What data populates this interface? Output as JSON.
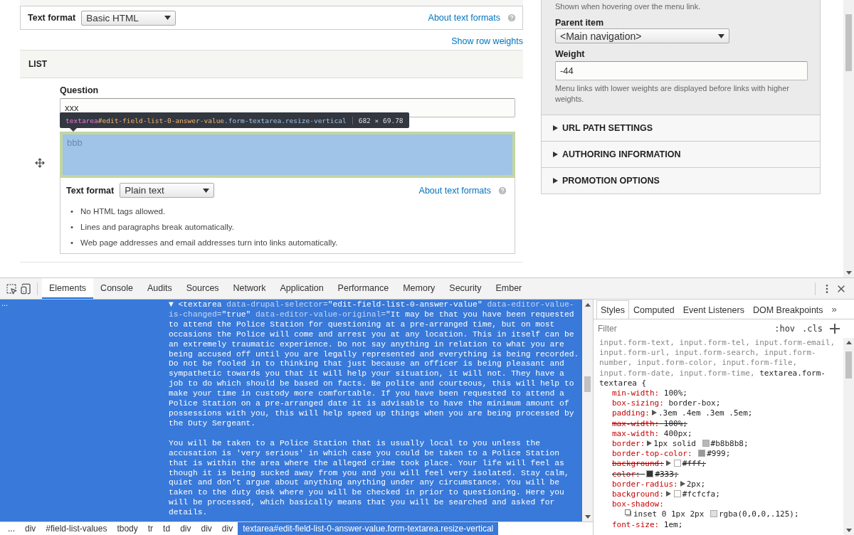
{
  "page": {
    "top_format": {
      "label": "Text format",
      "select": "Basic HTML",
      "link": "About text formats"
    },
    "show_row_weights": "Show row weights",
    "list_header": "LIST",
    "question": {
      "label": "Question",
      "value": "xxx"
    },
    "answer": {
      "value": "bbb",
      "highlighted": true
    },
    "tooltip": {
      "tag": "textarea",
      "id": "#edit-field-list-0-answer-value",
      "classes": ".form-textarea.resize-vertical",
      "size": "682 × 69.78"
    },
    "answer_format": {
      "label": "Text format",
      "select": "Plain text",
      "link": "About text formats",
      "bullet": "•",
      "tips": [
        "No HTML tags allowed.",
        "Lines and paragraphs break automatically.",
        "Web page addresses and email addresses turn into links automatically."
      ]
    }
  },
  "sidebar": {
    "hover_note": "Shown when hovering over the menu link.",
    "parent_label": "Parent item",
    "parent_select": "<Main navigation>",
    "weight_label": "Weight",
    "weight_value": "-44",
    "weight_note": "Menu links with lower weights are displayed before links with higher weights.",
    "sections": [
      {
        "title": "URL PATH SETTINGS",
        "expanded": false
      },
      {
        "title": "AUTHORING INFORMATION",
        "expanded": false
      },
      {
        "title": "PROMOTION OPTIONS",
        "expanded": false
      }
    ]
  },
  "devtools": {
    "tabs": [
      {
        "label": "Elements",
        "selected": true
      },
      {
        "label": "Console",
        "selected": false
      },
      {
        "label": "Audits",
        "selected": false
      },
      {
        "label": "Sources",
        "selected": false
      },
      {
        "label": "Network",
        "selected": false
      },
      {
        "label": "Application",
        "selected": false
      },
      {
        "label": "Performance",
        "selected": false
      },
      {
        "label": "Memory",
        "selected": false
      },
      {
        "label": "Security",
        "selected": false
      },
      {
        "label": "Ember",
        "selected": false
      }
    ],
    "dom": {
      "gutter": "...",
      "toggle": "▼",
      "element": [
        {
          "kind": "tag",
          "text": "<textarea"
        },
        {
          "kind": "attr",
          "text": " data-drupal-selector="
        },
        {
          "kind": "value",
          "text": "\"edit-field-list-0-answer-value\""
        },
        {
          "kind": "attr",
          "text": " data-editor-value-is-changed="
        },
        {
          "kind": "value",
          "text": "\"true\""
        },
        {
          "kind": "attr",
          "text": " data-editor-value-original="
        },
        {
          "kind": "value",
          "text": "\"It may be that you have been requested to attend the Police Station for questioning at a pre-arranged time, but on most occasions the Police will come and arrest you at any location. This in itself can be an extremely traumatic experience. Do not say anything in relation to what you are being accused off until you are legally represented and everything is being recorded. Do not be fooled in to thinking that just because an officer is being pleasant and sympathetic towards you that it will help your situation, it will not. They have a job to do which should be based on facts. Be polite and courteous, this will help to make your time in custody more comfortable. If you have been requested to attend a Police Station on a pre-arranged date it is advisable to have the minimum amount of possessions with you, this will help speed up things when you are being processed by the Duty Sergeant."
        }
      ],
      "text": "You will be taken to a Police Station that is usually local to you unless the accusation is 'very serious' in which case you could be taken to a Police Station that is within the area where the alleged crime took place. Your life will feel as though it is being sucked away from you and you will feel very isolated. Stay calm, quiet and don't argue about anything anything under any circumstance. You will be taken to the duty desk where you will be checked in prior to questioning. Here you will be processed, which basically means that you will be searched and asked for details."
    },
    "styles_tabs": [
      {
        "label": "Styles",
        "selected": true
      },
      {
        "label": "Computed",
        "selected": false
      },
      {
        "label": "Event Listeners",
        "selected": false
      },
      {
        "label": "DOM Breakpoints",
        "selected": false
      }
    ],
    "more": "»",
    "filter_placeholder": "Filter",
    "hov": ":hov",
    "cls": ".cls",
    "rule": {
      "selector": [
        {
          "text": "input.form-text, input.form-tel, input.form-email, input.form-url, input.form-search, input.form-number, input.form-color, input.form-file, input.form-date, input.form-time, ",
          "matched": false
        },
        {
          "text": "textarea.form-textarea",
          "matched": true
        }
      ],
      "brace": "{",
      "properties": [
        {
          "kind": "plain",
          "name": "min-width:",
          "value": "100%;",
          "struck": false
        },
        {
          "kind": "plain",
          "name": "box-sizing:",
          "value": "border-box;",
          "struck": false
        },
        {
          "kind": "plain",
          "name": "padding:",
          "value": ".3em .4em .3em .5em;",
          "struck": false,
          "expandable": true
        },
        {
          "kind": "plain",
          "name": "max-width:",
          "value": "100%;",
          "struck": true
        },
        {
          "kind": "plain",
          "name": "max-width:",
          "value": "400px;",
          "struck": false
        },
        {
          "kind": "color",
          "name": "border:",
          "value": "1px solid",
          "color": "#b8b8b8",
          "color_text": "#b8b8b8;",
          "struck": false,
          "expandable": true
        },
        {
          "kind": "color",
          "name": "border-top-color:",
          "color": "#999999",
          "color_text": "#999;",
          "struck": false
        },
        {
          "kind": "color",
          "name": "background:",
          "color": "#ffffff",
          "color_text": "#fff;",
          "struck": true,
          "expandable": true
        },
        {
          "kind": "color",
          "name": "color:",
          "color": "#333333",
          "color_text": "#333;",
          "struck": true
        },
        {
          "kind": "plain",
          "name": "border-radius:",
          "value": "2px;",
          "struck": false,
          "expandable": true
        },
        {
          "kind": "color",
          "name": "background:",
          "color": "#fcfcfa",
          "color_text": "#fcfcfa;",
          "struck": false,
          "expandable": true
        },
        {
          "kind": "shadow",
          "name": "box-shadow:",
          "value": "inset 0 1px 2px",
          "color": "#e0e0e0",
          "color_text": "rgba(0,0,0,.125);",
          "struck": false
        },
        {
          "kind": "plain",
          "name": "font-size:",
          "value": "1em;",
          "struck": false
        }
      ]
    },
    "breadcrumbs": [
      {
        "label": "...",
        "selected": false
      },
      {
        "label": "div",
        "selected": false
      },
      {
        "label": "#field-list-values",
        "selected": false
      },
      {
        "label": "tbody",
        "selected": false
      },
      {
        "label": "tr",
        "selected": false
      },
      {
        "label": "td",
        "selected": false
      },
      {
        "label": "div",
        "selected": false
      },
      {
        "label": "div",
        "selected": false
      },
      {
        "label": "div",
        "selected": false
      },
      {
        "label": "textarea#edit-field-list-0-answer-value.form-textarea.resize-vertical",
        "selected": true
      }
    ]
  }
}
